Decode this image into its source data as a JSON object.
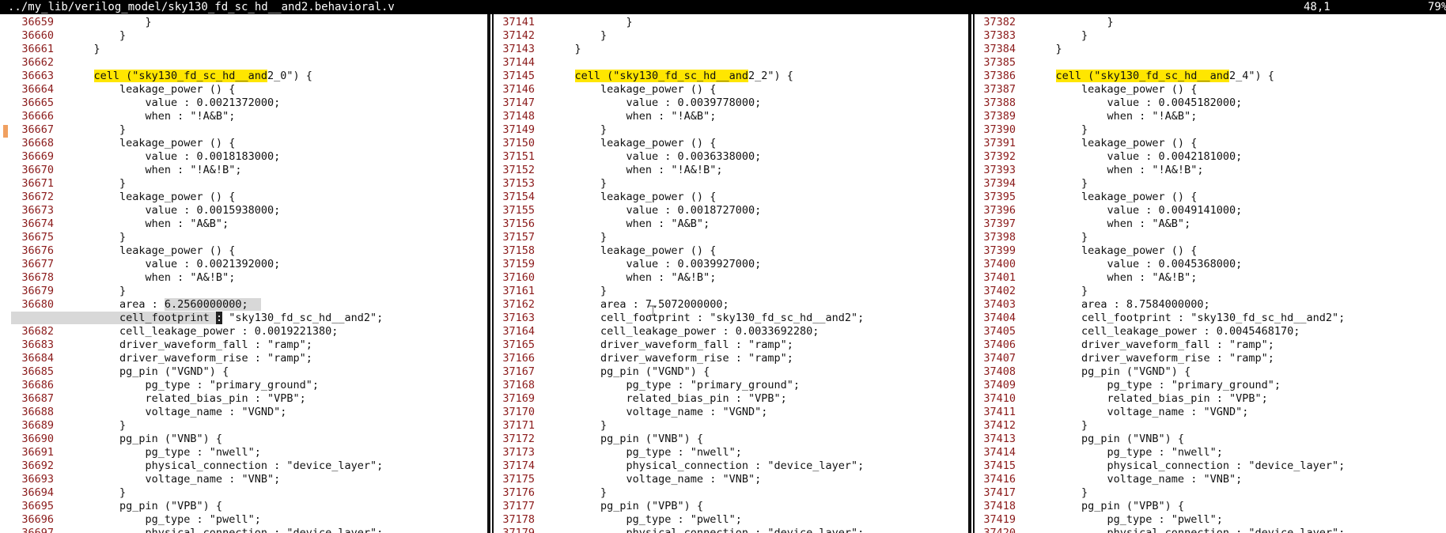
{
  "statusbar": {
    "path": "../my_lib/verilog_model/sky130_fd_sc_hd__and2.behavioral.v",
    "position": "48,1",
    "percent": "79%"
  },
  "panes": [
    {
      "lines": [
        {
          "n": "36659",
          "t": "            }"
        },
        {
          "n": "36660",
          "t": "        }"
        },
        {
          "n": "36661",
          "t": "    }"
        },
        {
          "n": "36662",
          "t": ""
        },
        {
          "n": "36663",
          "t": "    cell (\"sky130_fd_sc_hd__and2_0\") {",
          "hl": "cell (\"sky130_fd_sc_hd__and"
        },
        {
          "n": "36664",
          "t": "        leakage_power () {"
        },
        {
          "n": "36665",
          "t": "            value : 0.0021372000;"
        },
        {
          "n": "36666",
          "t": "            when : \"!A&B\";"
        },
        {
          "n": "36667",
          "t": "        }"
        },
        {
          "n": "36668",
          "t": "        leakage_power () {"
        },
        {
          "n": "36669",
          "t": "            value : 0.0018183000;"
        },
        {
          "n": "36670",
          "t": "            when : \"!A&!B\";"
        },
        {
          "n": "36671",
          "t": "        }"
        },
        {
          "n": "36672",
          "t": "        leakage_power () {"
        },
        {
          "n": "36673",
          "t": "            value : 0.0015938000;"
        },
        {
          "n": "36674",
          "t": "            when : \"A&B\";"
        },
        {
          "n": "36675",
          "t": "        }"
        },
        {
          "n": "36676",
          "t": "        leakage_power () {"
        },
        {
          "n": "36677",
          "t": "            value : 0.0021392000;"
        },
        {
          "n": "36678",
          "t": "            when : \"A&!B\";"
        },
        {
          "n": "36679",
          "t": "        }"
        },
        {
          "n": "36680",
          "t": "        area : 6.2560000000;"
        },
        {
          "n": "36681",
          "t": "        cell_footprint : \"sky130_fd_sc_hd__and2\";"
        },
        {
          "n": "36682",
          "t": "        cell_leakage_power : 0.0019221380;"
        },
        {
          "n": "36683",
          "t": "        driver_waveform_fall : \"ramp\";"
        },
        {
          "n": "36684",
          "t": "        driver_waveform_rise : \"ramp\";"
        },
        {
          "n": "36685",
          "t": "        pg_pin (\"VGND\") {"
        },
        {
          "n": "36686",
          "t": "            pg_type : \"primary_ground\";"
        },
        {
          "n": "36687",
          "t": "            related_bias_pin : \"VPB\";"
        },
        {
          "n": "36688",
          "t": "            voltage_name : \"VGND\";"
        },
        {
          "n": "36689",
          "t": "        }"
        },
        {
          "n": "36690",
          "t": "        pg_pin (\"VNB\") {"
        },
        {
          "n": "36691",
          "t": "            pg_type : \"nwell\";"
        },
        {
          "n": "36692",
          "t": "            physical_connection : \"device_layer\";"
        },
        {
          "n": "36693",
          "t": "            voltage_name : \"VNB\";"
        },
        {
          "n": "36694",
          "t": "        }"
        },
        {
          "n": "36695",
          "t": "        pg_pin (\"VPB\") {"
        },
        {
          "n": "36696",
          "t": "            pg_type : \"pwell\";"
        },
        {
          "n": "36697",
          "t": "            physical_connection : \"device_layer\";"
        }
      ]
    },
    {
      "lines": [
        {
          "n": "37141",
          "t": "            }"
        },
        {
          "n": "37142",
          "t": "        }"
        },
        {
          "n": "37143",
          "t": "    }"
        },
        {
          "n": "37144",
          "t": ""
        },
        {
          "n": "37145",
          "t": "    cell (\"sky130_fd_sc_hd__and2_2\") {",
          "hl": "cell (\"sky130_fd_sc_hd__and"
        },
        {
          "n": "37146",
          "t": "        leakage_power () {"
        },
        {
          "n": "37147",
          "t": "            value : 0.0039778000;"
        },
        {
          "n": "37148",
          "t": "            when : \"!A&B\";"
        },
        {
          "n": "37149",
          "t": "        }"
        },
        {
          "n": "37150",
          "t": "        leakage_power () {"
        },
        {
          "n": "37151",
          "t": "            value : 0.0036338000;"
        },
        {
          "n": "37152",
          "t": "            when : \"!A&!B\";"
        },
        {
          "n": "37153",
          "t": "        }"
        },
        {
          "n": "37154",
          "t": "        leakage_power () {"
        },
        {
          "n": "37155",
          "t": "            value : 0.0018727000;"
        },
        {
          "n": "37156",
          "t": "            when : \"A&B\";"
        },
        {
          "n": "37157",
          "t": "        }"
        },
        {
          "n": "37158",
          "t": "        leakage_power () {"
        },
        {
          "n": "37159",
          "t": "            value : 0.0039927000;"
        },
        {
          "n": "37160",
          "t": "            when : \"A&!B\";"
        },
        {
          "n": "37161",
          "t": "        }"
        },
        {
          "n": "37162",
          "t": "        area : 7.5072000000;"
        },
        {
          "n": "37163",
          "t": "        cell_footprint : \"sky130_fd_sc_hd__and2\";"
        },
        {
          "n": "37164",
          "t": "        cell_leakage_power : 0.0033692280;"
        },
        {
          "n": "37165",
          "t": "        driver_waveform_fall : \"ramp\";"
        },
        {
          "n": "37166",
          "t": "        driver_waveform_rise : \"ramp\";"
        },
        {
          "n": "37167",
          "t": "        pg_pin (\"VGND\") {"
        },
        {
          "n": "37168",
          "t": "            pg_type : \"primary_ground\";"
        },
        {
          "n": "37169",
          "t": "            related_bias_pin : \"VPB\";"
        },
        {
          "n": "37170",
          "t": "            voltage_name : \"VGND\";"
        },
        {
          "n": "37171",
          "t": "        }"
        },
        {
          "n": "37172",
          "t": "        pg_pin (\"VNB\") {"
        },
        {
          "n": "37173",
          "t": "            pg_type : \"nwell\";"
        },
        {
          "n": "37174",
          "t": "            physical_connection : \"device_layer\";"
        },
        {
          "n": "37175",
          "t": "            voltage_name : \"VNB\";"
        },
        {
          "n": "37176",
          "t": "        }"
        },
        {
          "n": "37177",
          "t": "        pg_pin (\"VPB\") {"
        },
        {
          "n": "37178",
          "t": "            pg_type : \"pwell\";"
        },
        {
          "n": "37179",
          "t": "            physical_connection : \"device_layer\";"
        }
      ]
    },
    {
      "lines": [
        {
          "n": "37382",
          "t": "            }"
        },
        {
          "n": "37383",
          "t": "        }"
        },
        {
          "n": "37384",
          "t": "    }"
        },
        {
          "n": "37385",
          "t": ""
        },
        {
          "n": "37386",
          "t": "    cell (\"sky130_fd_sc_hd__and2_4\") {",
          "hl": "cell (\"sky130_fd_sc_hd__and"
        },
        {
          "n": "37387",
          "t": "        leakage_power () {"
        },
        {
          "n": "37388",
          "t": "            value : 0.0045182000;"
        },
        {
          "n": "37389",
          "t": "            when : \"!A&B\";"
        },
        {
          "n": "37390",
          "t": "        }"
        },
        {
          "n": "37391",
          "t": "        leakage_power () {"
        },
        {
          "n": "37392",
          "t": "            value : 0.0042181000;"
        },
        {
          "n": "37393",
          "t": "            when : \"!A&!B\";"
        },
        {
          "n": "37394",
          "t": "        }"
        },
        {
          "n": "37395",
          "t": "        leakage_power () {"
        },
        {
          "n": "37396",
          "t": "            value : 0.0049141000;"
        },
        {
          "n": "37397",
          "t": "            when : \"A&B\";"
        },
        {
          "n": "37398",
          "t": "        }"
        },
        {
          "n": "37399",
          "t": "        leakage_power () {"
        },
        {
          "n": "37400",
          "t": "            value : 0.0045368000;"
        },
        {
          "n": "37401",
          "t": "            when : \"A&!B\";"
        },
        {
          "n": "37402",
          "t": "        }"
        },
        {
          "n": "37403",
          "t": "        area : 8.7584000000;"
        },
        {
          "n": "37404",
          "t": "        cell_footprint : \"sky130_fd_sc_hd__and2\";"
        },
        {
          "n": "37405",
          "t": "        cell_leakage_power : 0.0045468170;"
        },
        {
          "n": "37406",
          "t": "        driver_waveform_fall : \"ramp\";"
        },
        {
          "n": "37407",
          "t": "        driver_waveform_rise : \"ramp\";"
        },
        {
          "n": "37408",
          "t": "        pg_pin (\"VGND\") {"
        },
        {
          "n": "37409",
          "t": "            pg_type : \"primary_ground\";"
        },
        {
          "n": "37410",
          "t": "            related_bias_pin : \"VPB\";"
        },
        {
          "n": "37411",
          "t": "            voltage_name : \"VGND\";"
        },
        {
          "n": "37412",
          "t": "        }"
        },
        {
          "n": "37413",
          "t": "        pg_pin (\"VNB\") {"
        },
        {
          "n": "37414",
          "t": "            pg_type : \"nwell\";"
        },
        {
          "n": "37415",
          "t": "            physical_connection : \"device_layer\";"
        },
        {
          "n": "37416",
          "t": "            voltage_name : \"VNB\";"
        },
        {
          "n": "37417",
          "t": "        }"
        },
        {
          "n": "37418",
          "t": "        pg_pin (\"VPB\") {"
        },
        {
          "n": "37419",
          "t": "            pg_type : \"pwell\";"
        },
        {
          "n": "37420",
          "t": "            physical_connection : \"device_layer\";"
        }
      ]
    }
  ],
  "colors": {
    "line_number": "#8b1a1a",
    "search_highlight": "#ffe600",
    "status_bg": "#000000"
  }
}
